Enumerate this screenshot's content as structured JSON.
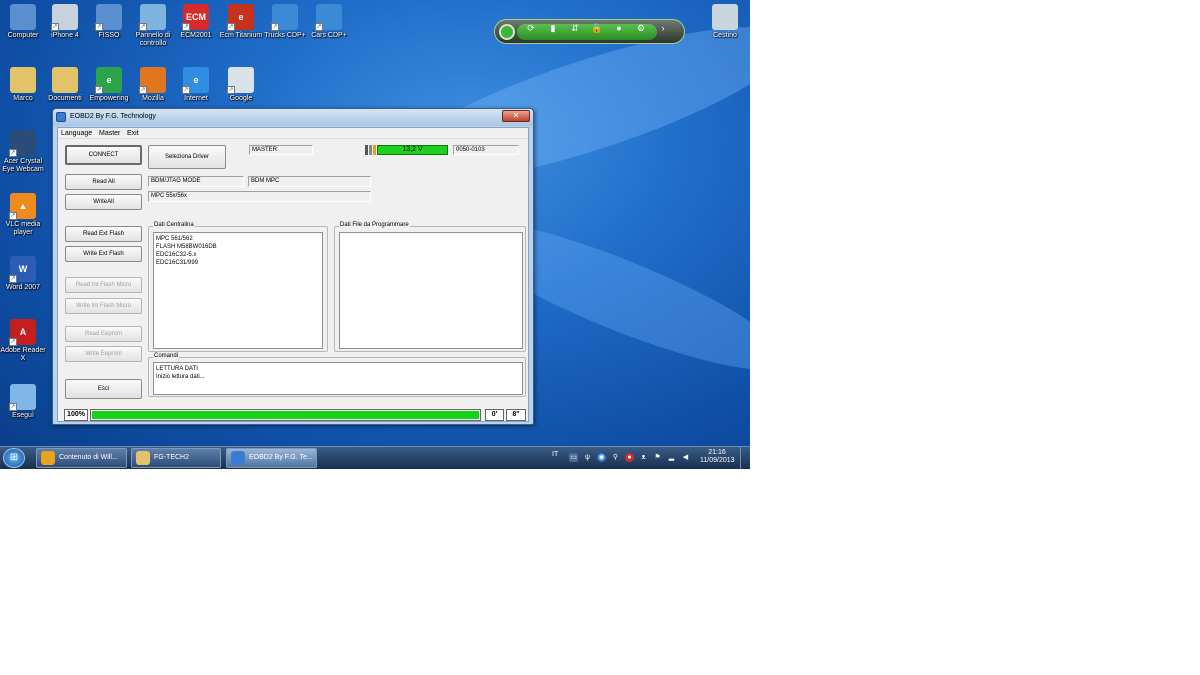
{
  "desktop": {
    "icons": [
      {
        "label": "Computer",
        "icon": "computer-icon",
        "color": "#5a8fd0",
        "glyph": ""
      },
      {
        "label": "iPhone 4",
        "icon": "iphone-icon",
        "color": "#c8d2de",
        "glyph": ""
      },
      {
        "label": "FISSO",
        "icon": "computer-shortcut-icon",
        "color": "#5a8fd0",
        "glyph": ""
      },
      {
        "label": "Pannello di controllo",
        "icon": "control-panel-icon",
        "color": "#7fb3e0",
        "glyph": ""
      },
      {
        "label": "ECM2001",
        "icon": "ecm-icon",
        "color": "#d32a2a",
        "glyph": "ECM"
      },
      {
        "label": "Ecm Titanium",
        "icon": "ecm-titanium-icon",
        "color": "#c7321c",
        "glyph": "e"
      },
      {
        "label": "Trucks CDP+",
        "icon": "truck-icon",
        "color": "#3a8ad6",
        "glyph": ""
      },
      {
        "label": "Cars CDP+",
        "icon": "car-icon",
        "color": "#3a8ad6",
        "glyph": ""
      },
      {
        "label": "Marco",
        "icon": "folder-icon",
        "color": "#e3c36a",
        "glyph": ""
      },
      {
        "label": "Documenti",
        "icon": "documents-folder-icon",
        "color": "#e3c36a",
        "glyph": ""
      },
      {
        "label": "Empowering",
        "icon": "ie-empowering-icon",
        "color": "#2aa34a",
        "glyph": "e"
      },
      {
        "label": "Mozilla",
        "icon": "firefox-icon",
        "color": "#e0761e",
        "glyph": ""
      },
      {
        "label": "Internet",
        "icon": "internet-explorer-icon",
        "color": "#2f8de4",
        "glyph": "e"
      },
      {
        "label": "Google",
        "icon": "google-icon",
        "color": "#d8e2e8",
        "glyph": ""
      },
      {
        "label": "Acer Crystal Eye Webcam",
        "icon": "webcam-icon",
        "color": "#2b4b78",
        "glyph": ""
      },
      {
        "label": "VLC media player",
        "icon": "vlc-icon",
        "color": "#f08a1c",
        "glyph": "▲"
      },
      {
        "label": "Word 2007",
        "icon": "word-icon",
        "color": "#2a5db3",
        "glyph": "W"
      },
      {
        "label": "Adobe Reader X",
        "icon": "adobe-reader-icon",
        "color": "#c41e1e",
        "glyph": "A"
      },
      {
        "label": "Eseguì",
        "icon": "run-icon",
        "color": "#7fb8e8",
        "glyph": ""
      },
      {
        "label": "Cestino",
        "icon": "recycle-bin-icon",
        "color": "#c9d6e0",
        "glyph": ""
      }
    ]
  },
  "gadget": {
    "icons": [
      "refresh-icon",
      "battery-icon",
      "signal-icon",
      "lock-icon",
      "chat-icon",
      "settings-icon",
      "arrow-icon"
    ]
  },
  "window": {
    "title": "EOBD2 By F.G. Technology",
    "close_glyph": "✕",
    "menu": [
      "Language",
      "Master",
      "Exit"
    ],
    "buttons": {
      "connect": "CONNECT",
      "seleziona": "Seleziona Driver",
      "read_all": "Read All",
      "write_all": "WriteAll",
      "read_ext": "Read Ext Flash",
      "write_ext": "Write Ext Flash",
      "read_int": "Read Int Flash Micro",
      "write_int": "Write Int Flash Micro",
      "read_eeprom": "Read Eeprom",
      "write_eeprom": "Write Eeprom",
      "esci": "Esci"
    },
    "fields": {
      "master": "MASTER",
      "code": "0050-0103",
      "mode": "BDM/JTAG  MODE",
      "bdm": "BDM MPC",
      "mpc": "MPC 55x/56x"
    },
    "voltage": {
      "value": "13,2 V",
      "color": "#1fd11f"
    },
    "groups": {
      "dati_centralina": {
        "label": "Dati Centralina",
        "items": [
          "MPC 561/562",
          "FLASH M58BW016DB",
          "EDC16C32-5.x",
          "EDC16C31/999"
        ]
      },
      "dati_file": {
        "label": "Dati File da Programmare",
        "items": []
      },
      "comandi": {
        "label": "Comandi",
        "items": [
          "LETTURA DATI",
          "Inizio lettura dati..."
        ]
      }
    },
    "status": {
      "percent_text": "100%",
      "progress": 1.0,
      "minutes": "0'",
      "seconds": "8''"
    }
  },
  "taskbar": {
    "tasks": [
      {
        "label": "Contenuto di Will...",
        "icon": "chrome-icon",
        "color": "#e6a51b",
        "active": false
      },
      {
        "label": "FG-TECH2",
        "icon": "folder-icon",
        "color": "#e3c36a",
        "active": false
      },
      {
        "label": "EOBD2 By F.G. Te...",
        "icon": "eobd2-icon",
        "color": "#3b7bd4",
        "active": true
      }
    ],
    "language": "IT",
    "time": "21:16",
    "date": "11/09/2013"
  }
}
